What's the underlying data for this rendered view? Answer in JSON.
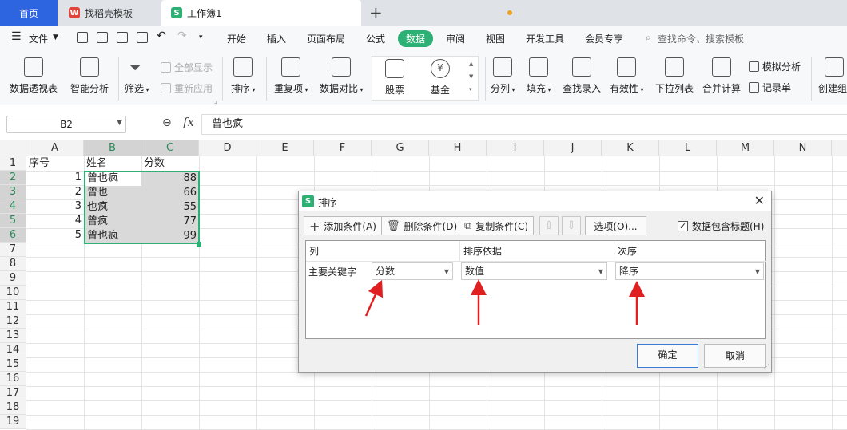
{
  "tabs": {
    "home": "首页",
    "template": "找稻壳模板",
    "workbook": "工作簿1",
    "new_tab": "+"
  },
  "menu": {
    "file": "文件",
    "items": [
      "开始",
      "插入",
      "页面布局",
      "公式",
      "数据",
      "审阅",
      "视图",
      "开发工具",
      "会员专享"
    ],
    "search_placeholder": "查找命令、搜索模板"
  },
  "ribbon": {
    "pivot": "数据透视表",
    "smart": "智能分析",
    "filter": "筛选",
    "show_all": "全部显示",
    "reapply": "重新应用",
    "sort": "排序",
    "duplicates": "重复项",
    "compare": "数据对比",
    "stock": "股票",
    "fund": "基金",
    "split": "分列",
    "fill": "填充",
    "lookup": "查找录入",
    "validity": "有效性",
    "dropdown": "下拉列表",
    "merge": "合并计算",
    "simulate": "模拟分析",
    "record": "记录单",
    "create_group": "创建组"
  },
  "formula_bar": {
    "name_box": "B2",
    "fx": "fx",
    "content": "曾也疯"
  },
  "sheet": {
    "columns": [
      "A",
      "B",
      "C",
      "D",
      "E",
      "F",
      "G",
      "H",
      "I",
      "J",
      "K",
      "L",
      "M",
      "N"
    ],
    "rows": [
      "1",
      "2",
      "3",
      "4",
      "5",
      "6",
      "7",
      "8",
      "9",
      "10",
      "11",
      "12",
      "13",
      "14",
      "15",
      "16",
      "17",
      "18",
      "19"
    ],
    "header": {
      "a": "序号",
      "b": "姓名",
      "c": "分数"
    },
    "data": [
      {
        "a": "1",
        "b": "曾也疯",
        "c": "88"
      },
      {
        "a": "2",
        "b": "曾也",
        "c": "66"
      },
      {
        "a": "3",
        "b": "也疯",
        "c": "55"
      },
      {
        "a": "4",
        "b": "曾疯",
        "c": "77"
      },
      {
        "a": "5",
        "b": "曾也疯",
        "c": "99"
      }
    ]
  },
  "dialog": {
    "title": "排序",
    "add": "添加条件(A)",
    "delete": "删除条件(D)",
    "copy": "复制条件(C)",
    "options": "选项(O)...",
    "header_check": "数据包含标题(H)",
    "col_header": "列",
    "basis_header": "排序依据",
    "order_header": "次序",
    "key_label": "主要关键字",
    "key_value": "分数",
    "basis_value": "数值",
    "order_value": "降序",
    "ok": "确定",
    "cancel": "取消"
  },
  "colors": {
    "accent_green": "#2db073",
    "home_tab_blue": "#2d64e0",
    "annotation_red": "#e02020"
  }
}
